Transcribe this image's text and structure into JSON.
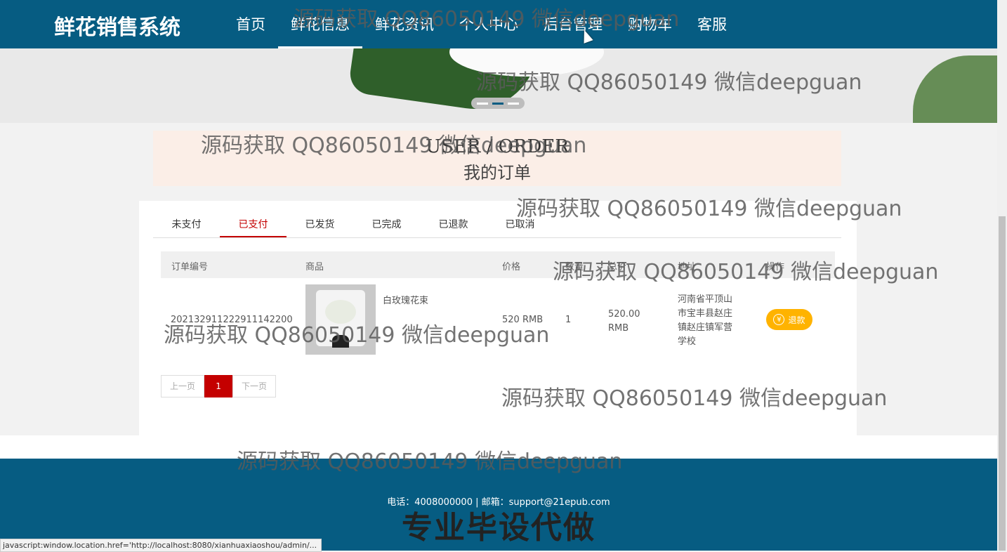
{
  "header": {
    "brand": "鲜花销售系统",
    "nav": [
      "首页",
      "鲜花信息",
      "鲜花资讯",
      "个人中心",
      "后台管理",
      "购物车",
      "客服"
    ],
    "active_index": 1
  },
  "title": {
    "en": "USER / ORDER",
    "cn": "我的订单"
  },
  "tabs": [
    "未支付",
    "已支付",
    "已发货",
    "已完成",
    "已退款",
    "已取消"
  ],
  "active_tab": 1,
  "table": {
    "headers": [
      "订单编号",
      "商品",
      "价格",
      "数量",
      "总价",
      "地址",
      "操作"
    ],
    "rows": [
      {
        "order_no": "2021329112229111422​00",
        "product": "白玫瑰花束",
        "price": "520 RMB",
        "qty": "1",
        "total": "520.00 RMB",
        "address": "河南省平顶山市宝丰县赵庄镇赵庄镇军营学校",
        "action": "退款"
      }
    ]
  },
  "pager": {
    "prev": "上一页",
    "current": "1",
    "next": "下一页"
  },
  "footer": {
    "contact": "电话：4008000000 | 邮箱：support@21epub.com",
    "slogan": "专业毕设代做"
  },
  "status_url": "javascript:window.location.href='http://localhost:8080/xianhuaxiaoshou/admin/...",
  "watermark": "源码获取 QQ86050149 微信deepguan",
  "colors": {
    "primary": "#065c82",
    "accent": "#c40000",
    "refund": "#ffb300"
  }
}
